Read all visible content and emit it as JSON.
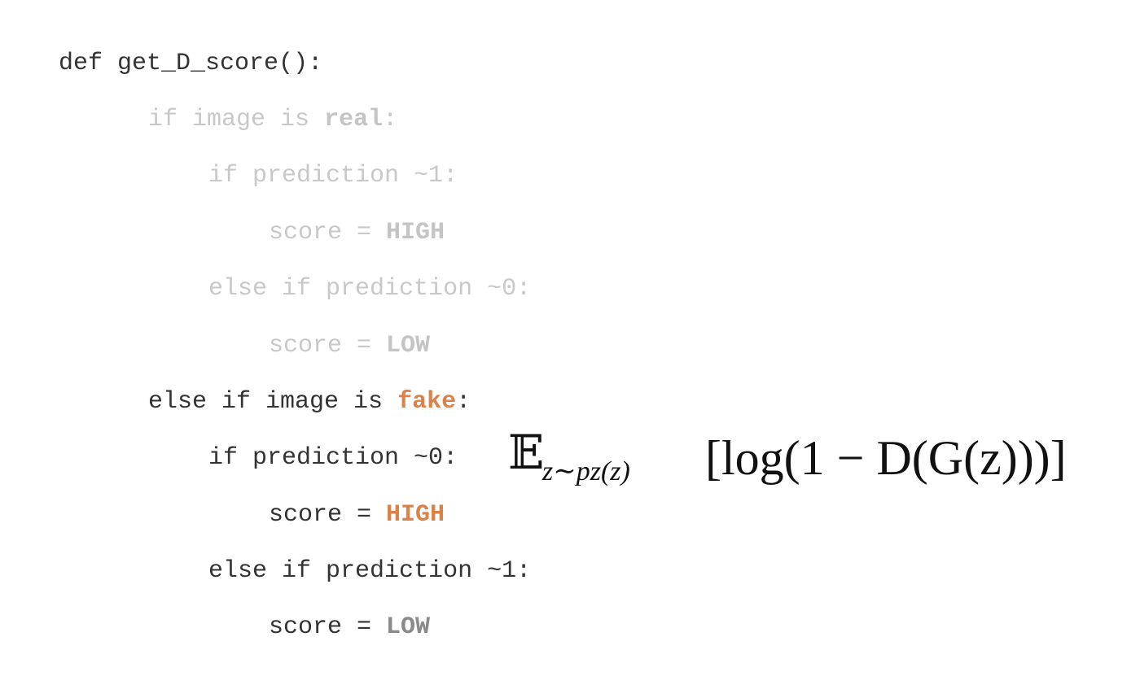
{
  "code": {
    "def_line": "def get_D_score():",
    "real_branch": {
      "if_prefix": "if image is ",
      "keyword": "real",
      "suffix": ":",
      "pred1": "if prediction ~1:",
      "score_prefix1": "score = ",
      "score_high": "HIGH",
      "pred0": "else if prediction ~0:",
      "score_prefix2": "score = ",
      "score_low": "LOW"
    },
    "fake_branch": {
      "if_prefix": "else if image is ",
      "keyword": "fake",
      "suffix": ":",
      "pred0": "if prediction ~0:",
      "score_prefix1": "score = ",
      "score_high": "HIGH",
      "pred1": "else if prediction ~1:",
      "score_prefix2": "score = ",
      "score_low": "LOW"
    }
  },
  "formula": {
    "expectation_symbol": "𝔼",
    "subscript": "z∼pz(z)",
    "body": "[log(1 − D(G(z)))]"
  },
  "colors": {
    "accent": "#d9824a",
    "faded": "#c8c8c8",
    "text": "#333333"
  }
}
